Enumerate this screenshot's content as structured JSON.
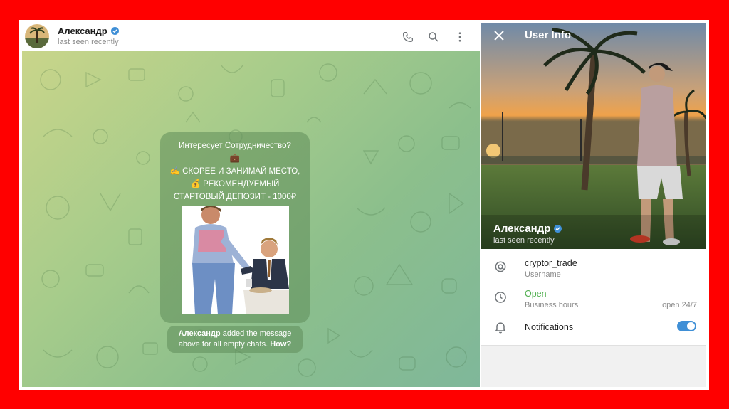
{
  "chat_header": {
    "name": "Александр",
    "status": "last seen recently",
    "icons": [
      "phone-icon",
      "search-icon",
      "more-icon"
    ]
  },
  "message": {
    "lines": [
      "Интересует Сотрудничество?",
      "💼",
      "✍️ СКОРЕЕ И ЗАНИМАЙ МЕСТО,",
      "💰 РЕКОМЕНДУЕМЫЙ",
      "СТАРТОВЫЙ ДЕПОЗИТ - 1000₽"
    ]
  },
  "system_note": {
    "name": "Александр",
    "text": "added the message above for all empty chats.",
    "link": "How?"
  },
  "user_info": {
    "title": "User Info",
    "name": "Александр",
    "status": "last seen recently",
    "username": "cryptor_trade",
    "username_label": "Username",
    "hours_status": "Open",
    "hours_label": "Business hours",
    "hours_value": "open 24/7",
    "notifications_label": "Notifications",
    "notifications_on": true
  },
  "colors": {
    "accent": "#3f8fd6",
    "open_green": "#4fae4e",
    "frame_border": "#ff0000"
  }
}
